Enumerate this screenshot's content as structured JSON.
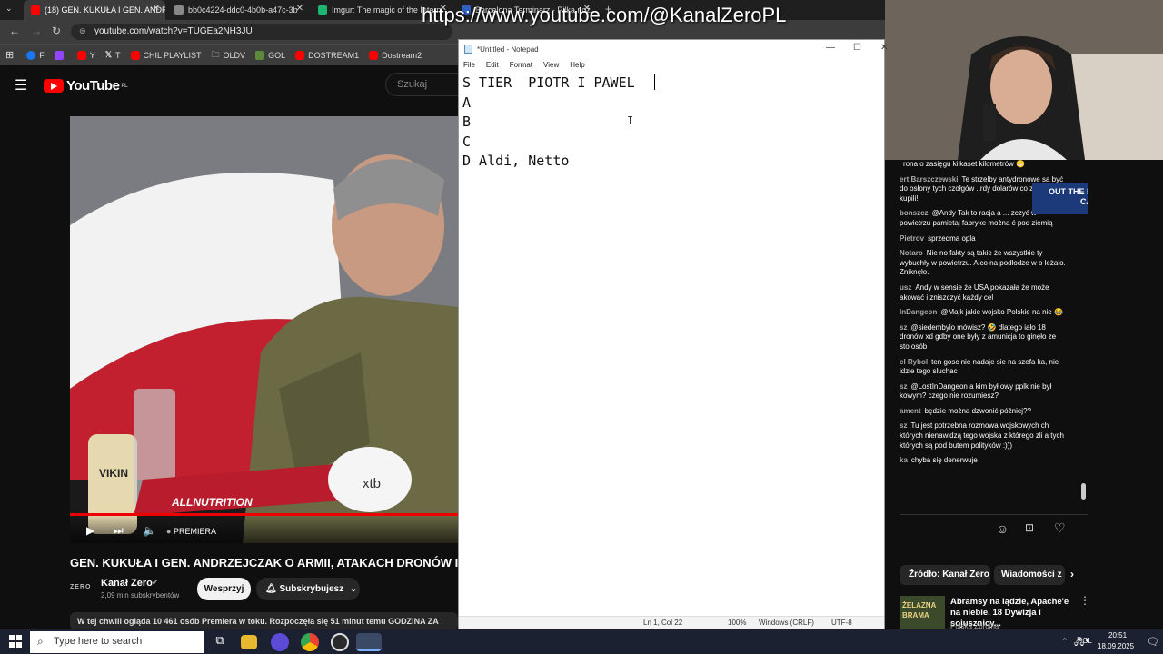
{
  "browser": {
    "tabs": [
      {
        "title": "(18) GEN. KUKUŁA I GEN. ANDR",
        "active": true,
        "favicon_color": "#ff0000"
      },
      {
        "title": "bb0c4224-ddc0-4b0b-a47c-3b",
        "active": false,
        "favicon_color": "#888888"
      },
      {
        "title": "Imgur: The magic of the Intern",
        "active": false,
        "favicon_color": "#1bb76e"
      },
      {
        "title": "Barcelona Terminarz - Piłka noż",
        "active": false,
        "favicon_color": "#3060c0"
      }
    ],
    "new_tab_icon": "plus-icon",
    "url": "youtube.com/watch?v=TUGEa2NH3JU",
    "bookmarks": [
      {
        "label": "F",
        "icon": "facebook-icon",
        "color": "#1877f2"
      },
      {
        "label": "",
        "icon": "twitch-icon",
        "color": "#9146ff"
      },
      {
        "label": "Y",
        "icon": "youtube-icon",
        "color": "#ff0000"
      },
      {
        "label": "T",
        "icon": "x-icon",
        "color": "#ffffff"
      },
      {
        "label": "CHIL PLAYLIST",
        "icon": "youtube-icon",
        "color": "#ff0000"
      },
      {
        "label": "OLDV",
        "icon": "folder-icon",
        "color": "#cccccc"
      },
      {
        "label": "GOL",
        "icon": "gol-icon",
        "color": "#5a8a3a"
      },
      {
        "label": "DOSTREAM1",
        "icon": "youtube-icon",
        "color": "#ff0000"
      },
      {
        "label": "Dostream2",
        "icon": "youtube-icon",
        "color": "#ff0000"
      }
    ]
  },
  "overlay": {
    "url_text": "https://www.youtube.com/@KanalZeroPL"
  },
  "youtube": {
    "logo_text": "YouTube",
    "region": "PL",
    "search_placeholder": "Szukaj",
    "player": {
      "premiere_label": "PREMIERA",
      "mug_brand": "xtb",
      "table_brand": "ALLNUTRITION",
      "bottle_text": "VIKIN"
    },
    "video_title": "GEN. KUKUŁA I GEN. ANDRZEJCZAK O ARMII, ATAKACH DRONÓW I ZA",
    "channel": {
      "name": "Kanał Zero",
      "subscribers": "2,09 mln subskrybentów",
      "logo_text": "ZERO"
    },
    "support_button": "Wesprzyj",
    "subscribe_button": "Subskrybujesz",
    "watching_text": "W tej chwili ogląda 10 461 osób  Premiera w toku. Rozpoczęła się 51 minut temu  GODZINA ZA"
  },
  "notepad": {
    "title": "*Untitled - Notepad",
    "menu": [
      "File",
      "Edit",
      "Format",
      "View",
      "Help"
    ],
    "lines": [
      "S TIER  PIOTR I PAWEL",
      "A",
      "B",
      "C",
      "D Aldi, Netto"
    ],
    "status": {
      "position": "Ln 1, Col 22",
      "zoom": "100%",
      "line_ending": "Windows (CRLF)",
      "encoding": "UTF-8"
    }
  },
  "chat": {
    "messages": [
      {
        "author": "",
        "text": "rona o zasięgu kilkaset kilometrów 😬"
      },
      {
        "author": "ert Barszczewski",
        "text": "Te strzelby antydronowe są być do osłony tych czołgów ..rdy dolarów co zeście kupili!"
      },
      {
        "author": "bonszcz",
        "text": "@Andy Tak to racja a ... zczyć w powietrzu pamietaj fabryke można ć pod ziemią"
      },
      {
        "author": "Pietrov",
        "text": "sprzedma opla"
      },
      {
        "author": "Notaro",
        "text": "Nie no fakty są takie że wszystkie ty wybuchły w powietrzu. A co na podłodze w o leżało. Zniknęło."
      },
      {
        "author": "usz",
        "text": "Andy w sensie że USA pokazała że może akować i zniszczyć każdy cel"
      },
      {
        "author": "InDangeon",
        "text": "@Majk jakie wojsko Polskie na nie 😂"
      },
      {
        "author": "sz",
        "text": "@siedembylo mówisz? 🤣 dlatego iało 18 dronów xd gdby one były z amunicja to ginęło ze sto osób"
      },
      {
        "author": "el Rybol",
        "text": "ten gosc nie nadaje sie na szefa ka, nie idzie tego sluchac"
      },
      {
        "author": "sz",
        "text": "@LostInDangeon a kim był owy pplk nie był kowym? czego nie rozumiesz?"
      },
      {
        "author": "ament",
        "text": "będzie można dzwonić później??"
      },
      {
        "author": "sz",
        "text": "Tu jest potrzebna rozmowa wojskowych ch których nienawidzą tego wojska z którego zli a tych których są pod butem polityków :)))"
      },
      {
        "author": "ka",
        "text": "chyba się denerwuje"
      }
    ],
    "badge_text": "OUT THE BEST CASES"
  },
  "related": {
    "chips": [
      "Źródło: Kanał Zero",
      "Wiadomości z"
    ],
    "video_title": "Abramsy na lądzie, Apache'e na niebie. 18 Dywizja i sojusznicy...",
    "video_channel": "Polska Zbrojna",
    "thumb_text": "ŻELAZNA BRAMA"
  },
  "taskbar": {
    "search_placeholder": "Type here to search",
    "language": "POL",
    "time": "20:51",
    "date": "18.09.2025"
  }
}
